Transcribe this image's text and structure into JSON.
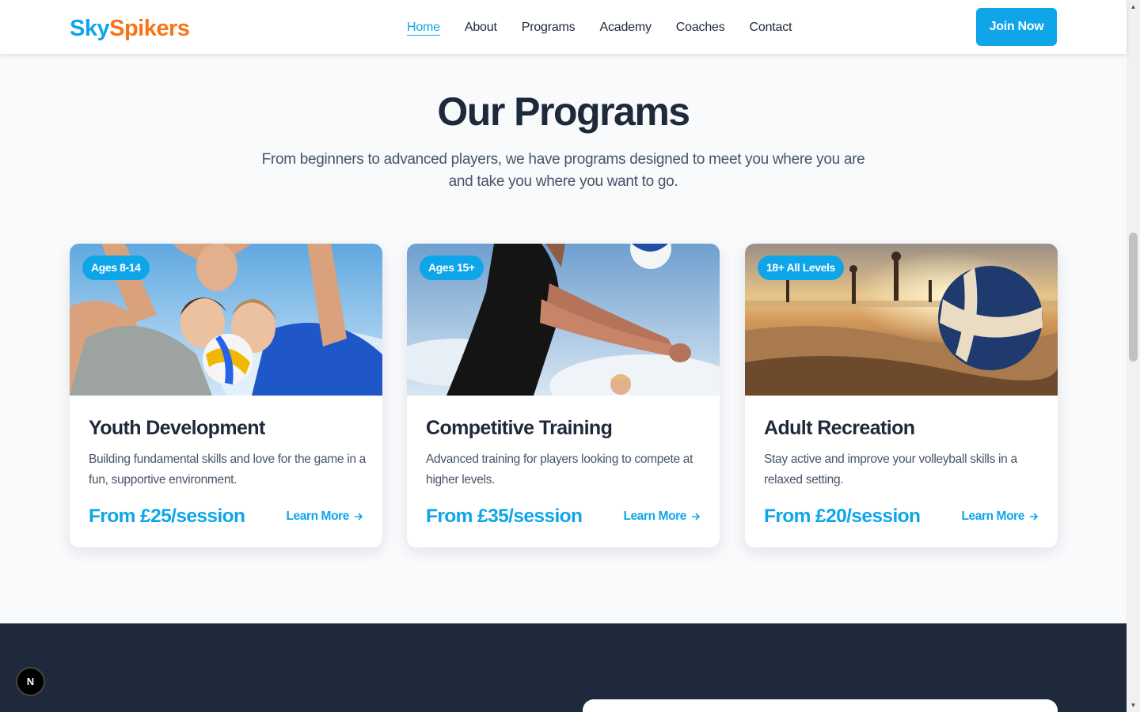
{
  "header": {
    "logo_part1": "Sky",
    "logo_part2": "Spikers",
    "nav": [
      "Home",
      "About",
      "Programs",
      "Academy",
      "Coaches",
      "Contact"
    ],
    "active_nav": "Home",
    "cta": "Join Now"
  },
  "section": {
    "title": "Our Programs",
    "subtitle": "From beginners to advanced players, we have programs designed to meet you where you are and take you where you want to go."
  },
  "programs": [
    {
      "badge": "Ages 8-14",
      "title": "Youth Development",
      "description": "Building fundamental skills and love for the game in a fun, supportive environment.",
      "price": "From £25/session",
      "link": "Learn More"
    },
    {
      "badge": "Ages 15+",
      "title": "Competitive Training",
      "description": "Advanced training for players looking to compete at higher levels.",
      "price": "From £35/session",
      "link": "Learn More"
    },
    {
      "badge": "18+ All Levels",
      "title": "Adult Recreation",
      "description": "Stay active and improve your volleyball skills in a relaxed setting.",
      "price": "From £20/session",
      "link": "Learn More"
    }
  ],
  "floating_badge": "N",
  "colors": {
    "accent": "#0ea5e9",
    "brand_orange": "#f97316",
    "dark": "#1e293b",
    "background": "#f8fafc"
  }
}
